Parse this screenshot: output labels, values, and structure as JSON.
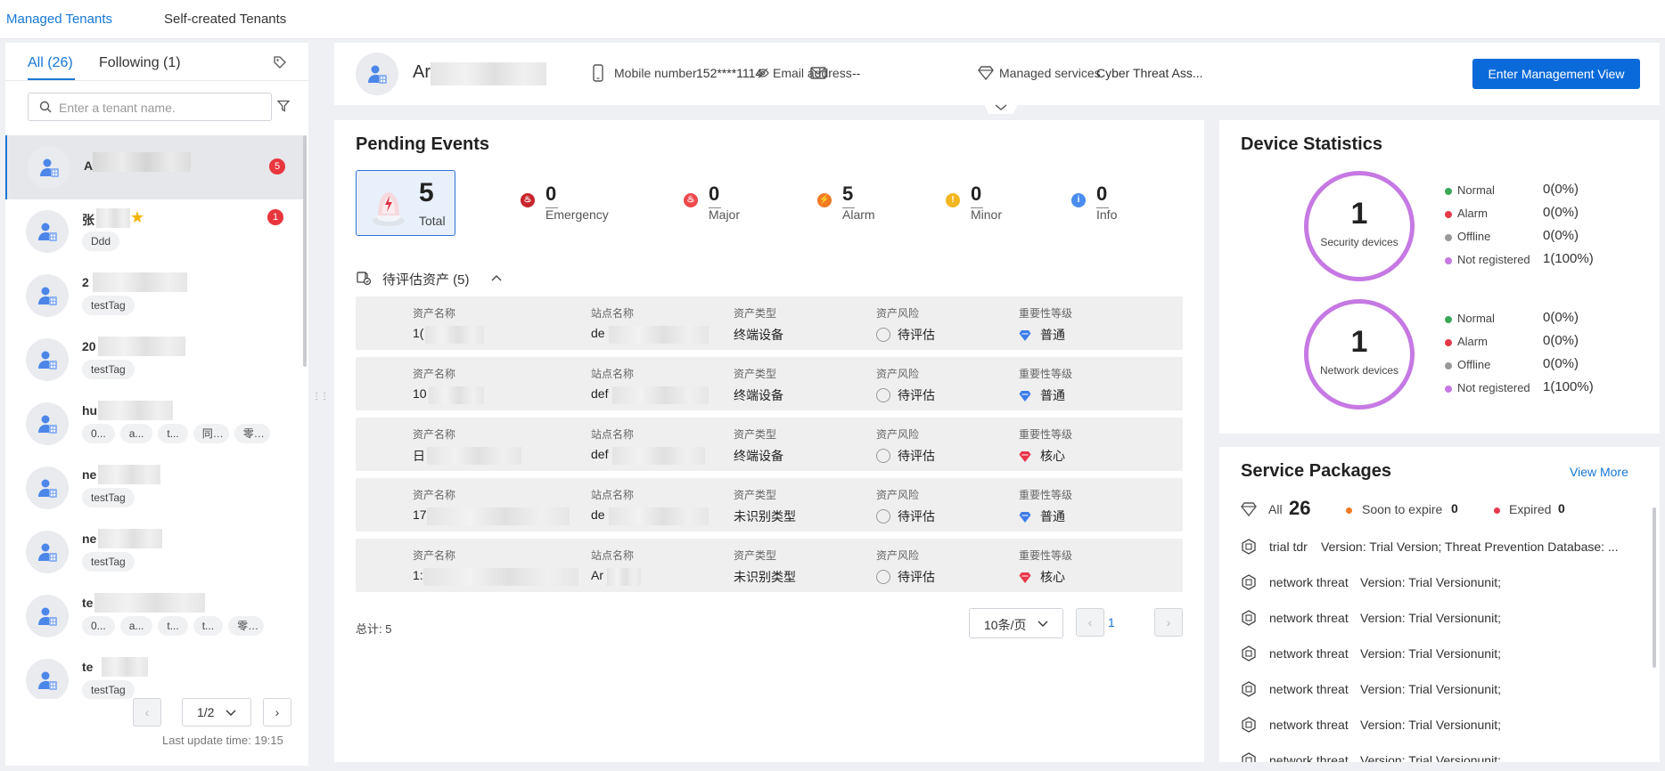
{
  "top_tabs": {
    "managed": "Managed Tenants",
    "self_created": "Self-created Tenants"
  },
  "left": {
    "tab_all": "All (26)",
    "tab_following": "Following (1)",
    "search_placeholder": "Enter a tenant name.",
    "tenants": [
      {
        "name": "A",
        "badge": "5",
        "tags": []
      },
      {
        "name": "张",
        "badge": "1",
        "tags": [
          "Ddd"
        ]
      },
      {
        "name": "2",
        "badge": "",
        "tags": [
          "testTag"
        ]
      },
      {
        "name": "20",
        "badge": "",
        "tags": [
          "testTag"
        ]
      },
      {
        "name": "hu",
        "badge": "",
        "tags": [
          "0...",
          "a...",
          "t...",
          "同...",
          "零..."
        ]
      },
      {
        "name": "ne",
        "badge": "",
        "tags": [
          "testTag"
        ]
      },
      {
        "name": "ne",
        "badge": "",
        "tags": [
          "testTag"
        ]
      },
      {
        "name": "te",
        "badge": "",
        "tags": [
          "0...",
          "a...",
          "t...",
          "t...",
          "零..."
        ]
      },
      {
        "name": "te",
        "badge": "",
        "tags": [
          "testTag"
        ]
      }
    ],
    "page_indicator": "1/2",
    "last_update": "Last update time: 19:15"
  },
  "header": {
    "name": "Ar",
    "mobile_label": "Mobile number",
    "mobile_value": "152****1114",
    "email_label": "Email address",
    "email_value": "--",
    "services_label": "Managed services",
    "services_value": "Cyber Threat Ass...",
    "enter_button": "Enter Management View"
  },
  "pending": {
    "title": "Pending Events",
    "total": {
      "value": "5",
      "label": "Total"
    },
    "levels": [
      {
        "value": "0",
        "label": "Emergency",
        "color": "#c8242b",
        "icon": "fire-icon"
      },
      {
        "value": "0",
        "label": "Major",
        "color": "#ee4a4e",
        "icon": "flame-icon"
      },
      {
        "value": "5",
        "label": "Alarm",
        "color": "#f07a25",
        "icon": "bolt-icon"
      },
      {
        "value": "0",
        "label": "Minor",
        "color": "#f3b61f",
        "icon": "exclamation-icon"
      },
      {
        "value": "0",
        "label": "Info",
        "color": "#4a8cf0",
        "icon": "info-icon"
      }
    ],
    "asset_section": "待评估资产 (5)",
    "col_labels": {
      "name": "资产名称",
      "site": "站点名称",
      "type": "资产类型",
      "risk": "资产风险",
      "level": "重要性等级"
    },
    "assets": [
      {
        "name": "1(",
        "site": "de",
        "type": "终端设备",
        "risk": "待评估",
        "level": "普通",
        "level_color": "#3d7ce8"
      },
      {
        "name": "10",
        "site": "def",
        "type": "终端设备",
        "risk": "待评估",
        "level": "普通",
        "level_color": "#3d7ce8"
      },
      {
        "name": "日",
        "site": "def",
        "type": "终端设备",
        "risk": "待评估",
        "level": "核心",
        "level_color": "#e8364a"
      },
      {
        "name": "17",
        "site": "de",
        "type": "未识别类型",
        "risk": "待评估",
        "level": "普通",
        "level_color": "#3d7ce8"
      },
      {
        "name": "1:",
        "site": "Ar",
        "type": "未识别类型",
        "risk": "待评估",
        "level": "核心",
        "level_color": "#e8364a"
      }
    ],
    "total_text": "总计: 5",
    "page_size": "10条/页",
    "page": "1"
  },
  "device_stats": {
    "title": "Device Statistics",
    "groups": [
      {
        "count": "1",
        "label": "Security devices",
        "legend": [
          {
            "label": "Normal",
            "value": "0(0%)",
            "color": "#3aa857"
          },
          {
            "label": "Alarm",
            "value": "0(0%)",
            "color": "#e5394a"
          },
          {
            "label": "Offline",
            "value": "0(0%)",
            "color": "#999999"
          },
          {
            "label": "Not registered",
            "value": "1(100%)",
            "color": "#c679e3"
          }
        ]
      },
      {
        "count": "1",
        "label": "Network devices",
        "legend": [
          {
            "label": "Normal",
            "value": "0(0%)",
            "color": "#3aa857"
          },
          {
            "label": "Alarm",
            "value": "0(0%)",
            "color": "#e5394a"
          },
          {
            "label": "Offline",
            "value": "0(0%)",
            "color": "#999999"
          },
          {
            "label": "Not registered",
            "value": "1(100%)",
            "color": "#c679e3"
          }
        ]
      }
    ]
  },
  "service_packages": {
    "title": "Service Packages",
    "view_more": "View More",
    "all_label": "All",
    "all_count": "26",
    "soon_label": "Soon to expire",
    "soon_count": "0",
    "expired_label": "Expired",
    "expired_count": "0",
    "items": [
      {
        "name": "trial tdr",
        "desc": "Version: Trial Version; Threat Prevention Database: ..."
      },
      {
        "name": "network threat",
        "desc": "Version: Trial Versionunit;"
      },
      {
        "name": "network threat",
        "desc": "Version: Trial Versionunit;"
      },
      {
        "name": "network threat",
        "desc": "Version: Trial Versionunit;"
      },
      {
        "name": "network threat",
        "desc": "Version: Trial Versionunit;"
      },
      {
        "name": "network threat",
        "desc": "Version: Trial Versionunit;"
      },
      {
        "name": "network threat",
        "desc": "Version: Trial Versionunit;"
      }
    ]
  }
}
